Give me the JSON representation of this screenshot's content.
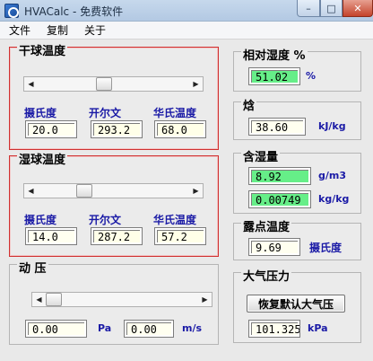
{
  "window": {
    "title": "HVACalc - 免费软件",
    "minimize": "–",
    "maximize": "□",
    "close": "✕"
  },
  "menu": [
    "文件",
    "复制",
    "关于"
  ],
  "dry_bulb": {
    "legend": "干球温度",
    "slider_value": 20.0,
    "celsius_label": "摄氏度",
    "kelvin_label": "开尔文",
    "fahrenheit_label": "华氏温度",
    "celsius": "20.0",
    "kelvin": "293.2",
    "fahrenheit": "68.0"
  },
  "wet_bulb": {
    "legend": "湿球温度",
    "slider_value": 14.0,
    "celsius_label": "摄氏度",
    "kelvin_label": "开尔文",
    "fahrenheit_label": "华氏温度",
    "celsius": "14.0",
    "kelvin": "287.2",
    "fahrenheit": "57.2"
  },
  "dynamic_pressure": {
    "legend": "动 压",
    "pa_value": "0.00",
    "pa_unit": "Pa",
    "ms_value": "0.00",
    "ms_unit": "m/s"
  },
  "relative_humidity": {
    "legend": "相对湿度 %",
    "value": "51.02",
    "unit": "%"
  },
  "enthalpy": {
    "legend": "焓",
    "value": "38.60",
    "unit": "kJ/kg"
  },
  "humidity_ratio": {
    "legend": "含湿量",
    "value_gm3": "8.92",
    "unit_gm3": "g/m3",
    "value_kgkg": "0.00749",
    "unit_kgkg": "kg/kg"
  },
  "dew_point": {
    "legend": "露点温度",
    "value": "9.69",
    "unit": "摄氏度"
  },
  "atmospheric_pressure": {
    "legend": "大气压力",
    "reset_button": "恢复默认大气压",
    "value": "101.325",
    "unit": "kPa"
  },
  "colors": {
    "accent_red": "#d03030",
    "label_blue": "#1a1aa6",
    "result_green": "#66ee88",
    "field_yellow": "#ffffe8"
  }
}
